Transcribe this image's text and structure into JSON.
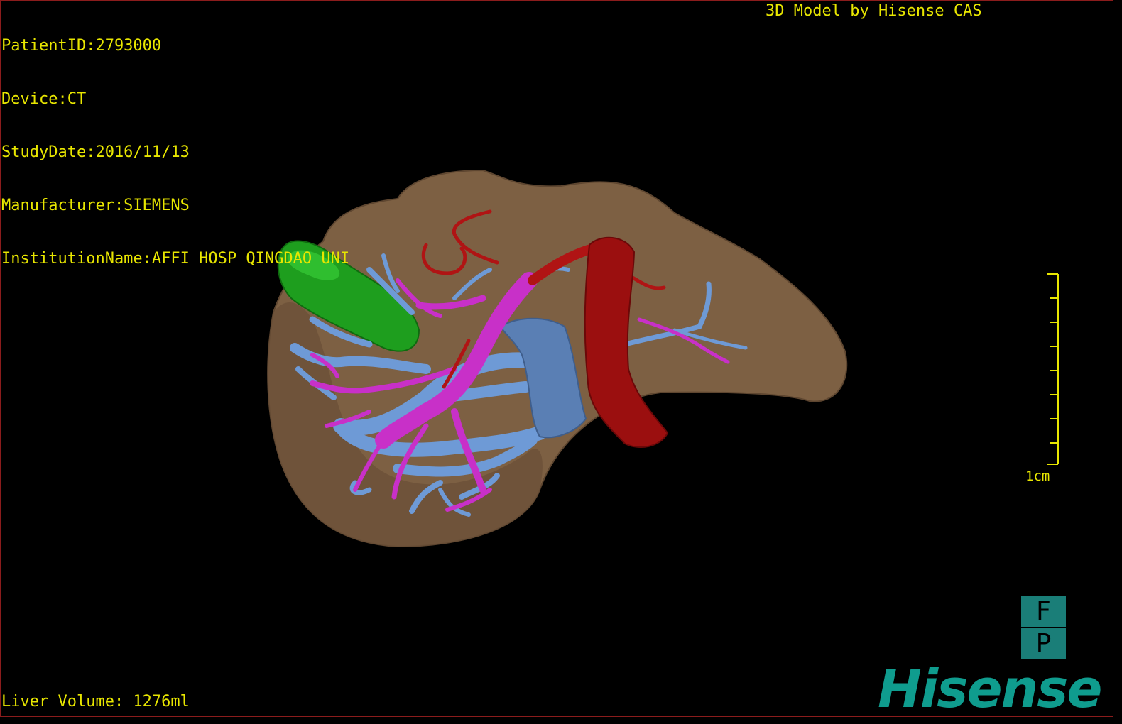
{
  "header": {
    "patient_id": "PatientID:2793000",
    "device": "Device:CT",
    "study_date": "StudyDate:2016/11/13",
    "manufacturer": "Manufacturer:SIEMENS",
    "institution": "InstitutionName:AFFI HOSP QINGDAO UNI",
    "credit": "3D Model by Hisense CAS"
  },
  "footer": {
    "liver_volume": "Liver Volume: 1276ml",
    "brand": "Hisense"
  },
  "scale_bar": {
    "label": "1cm"
  },
  "orientation": {
    "top": "F",
    "bottom": "P"
  },
  "colors": {
    "liver": "#7d6043",
    "gallbladder": "#1e9e1e",
    "portal_vein": "#6e9ad6",
    "hepatic_artery": "#c830c8",
    "vena_cava": "#9b0f0f",
    "text": "#e8e600",
    "brand": "#0f9c8e"
  }
}
